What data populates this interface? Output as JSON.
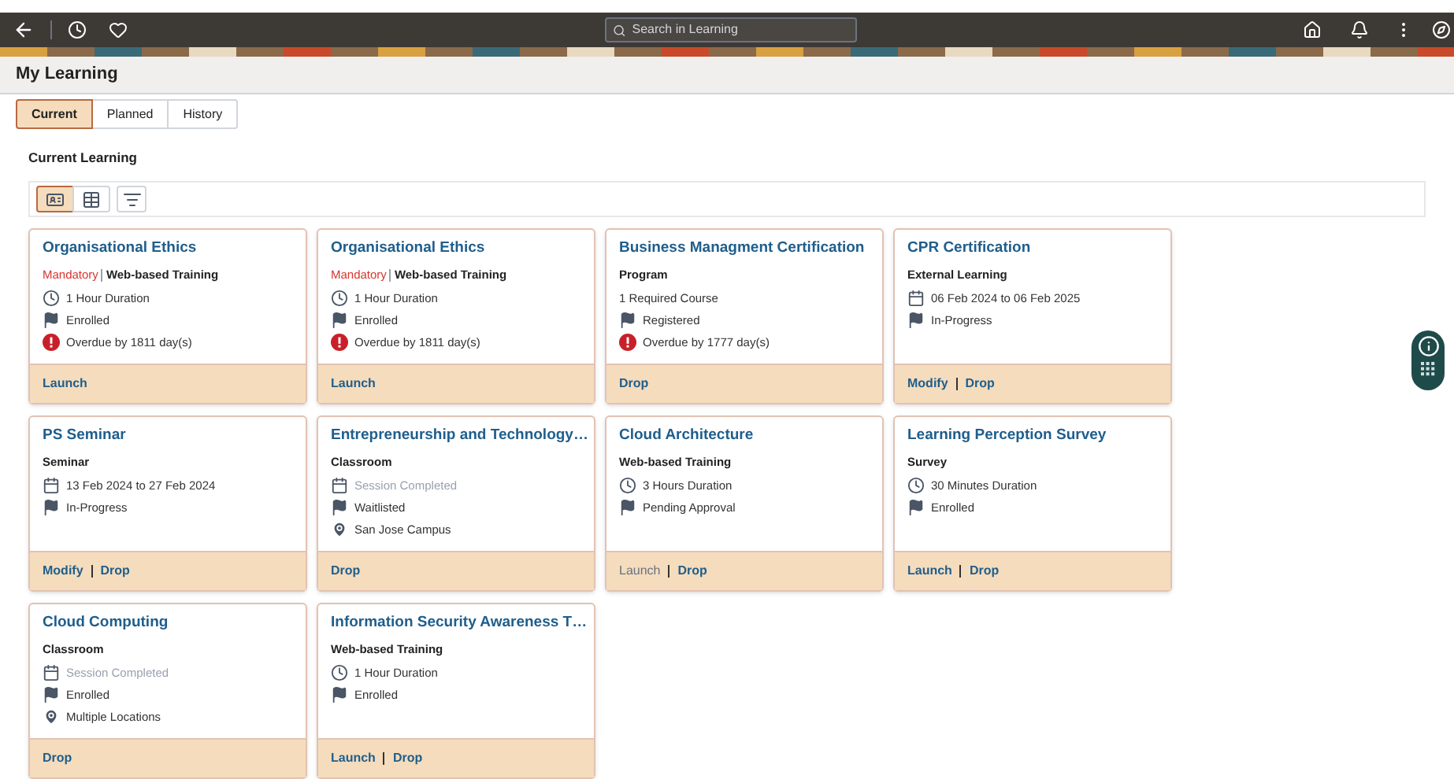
{
  "search": {
    "placeholder": "Search in Learning"
  },
  "page_title": "My Learning",
  "tabs": [
    {
      "label": "Current",
      "selected": true
    },
    {
      "label": "Planned",
      "selected": false
    },
    {
      "label": "History",
      "selected": false
    }
  ],
  "section_title": "Current Learning",
  "view_buttons": [
    {
      "kind": "cards",
      "selected": true
    },
    {
      "kind": "table",
      "selected": false
    },
    {
      "kind": "filter",
      "selected": false
    }
  ],
  "cards": [
    {
      "title": "Organisational Ethics",
      "mandatory": "Mandatory",
      "type": "Web-based Training",
      "lines": [
        {
          "kind": "duration",
          "text": "1 Hour Duration",
          "disabled": false
        },
        {
          "kind": "status",
          "text": "Enrolled",
          "disabled": false
        },
        {
          "kind": "overdue",
          "text": "Overdue by 1811 day(s)",
          "disabled": false
        }
      ],
      "actions": [
        {
          "label": "Launch",
          "disabled": false
        }
      ]
    },
    {
      "title": "Organisational Ethics",
      "mandatory": "Mandatory",
      "type": "Web-based Training",
      "lines": [
        {
          "kind": "duration",
          "text": "1 Hour Duration",
          "disabled": false
        },
        {
          "kind": "status",
          "text": "Enrolled",
          "disabled": false
        },
        {
          "kind": "overdue",
          "text": "Overdue by 1811 day(s)",
          "disabled": false
        }
      ],
      "actions": [
        {
          "label": "Launch",
          "disabled": false
        }
      ]
    },
    {
      "title": "Business Managment Certification",
      "type": "Program",
      "lines": [
        {
          "kind": "text",
          "text": "1 Required Course",
          "disabled": false
        },
        {
          "kind": "status",
          "text": "Registered",
          "disabled": false
        },
        {
          "kind": "overdue",
          "text": "Overdue by 1777 day(s)",
          "disabled": false
        }
      ],
      "actions": [
        {
          "label": "Drop",
          "disabled": false
        }
      ]
    },
    {
      "title": "CPR Certification",
      "type": "External Learning",
      "lines": [
        {
          "kind": "dates",
          "text": "06 Feb 2024 to 06 Feb 2025",
          "disabled": false
        },
        {
          "kind": "status",
          "text": "In-Progress",
          "disabled": false
        }
      ],
      "actions": [
        {
          "label": "Modify",
          "disabled": false
        },
        {
          "label": "Drop",
          "disabled": false
        }
      ]
    },
    {
      "title": "PS Seminar",
      "type": "Seminar",
      "lines": [
        {
          "kind": "dates",
          "text": "13 Feb 2024 to 27 Feb 2024",
          "disabled": false
        },
        {
          "kind": "status",
          "text": "In-Progress",
          "disabled": false
        }
      ],
      "actions": [
        {
          "label": "Modify",
          "disabled": false
        },
        {
          "label": "Drop",
          "disabled": false
        }
      ]
    },
    {
      "title": "Entrepreneurship and Technology…",
      "type": "Classroom",
      "lines": [
        {
          "kind": "dates",
          "text": "Session Completed",
          "disabled": true
        },
        {
          "kind": "status",
          "text": "Waitlisted",
          "disabled": false
        },
        {
          "kind": "location",
          "text": "San Jose Campus",
          "disabled": false
        }
      ],
      "actions": [
        {
          "label": "Drop",
          "disabled": false
        }
      ]
    },
    {
      "title": "Cloud Architecture",
      "type": "Web-based Training",
      "lines": [
        {
          "kind": "duration",
          "text": "3 Hours Duration",
          "disabled": false
        },
        {
          "kind": "status",
          "text": "Pending Approval",
          "disabled": false
        }
      ],
      "actions": [
        {
          "label": "Launch",
          "disabled": true
        },
        {
          "label": "Drop",
          "disabled": false
        }
      ]
    },
    {
      "title": "Learning Perception Survey",
      "type": "Survey",
      "lines": [
        {
          "kind": "duration",
          "text": "30 Minutes Duration",
          "disabled": false
        },
        {
          "kind": "status",
          "text": "Enrolled",
          "disabled": false
        }
      ],
      "actions": [
        {
          "label": "Launch",
          "disabled": false
        },
        {
          "label": "Drop",
          "disabled": false
        }
      ]
    },
    {
      "title": "Cloud Computing",
      "type": "Classroom",
      "lines": [
        {
          "kind": "dates",
          "text": "Session Completed",
          "disabled": true
        },
        {
          "kind": "status",
          "text": "Enrolled",
          "disabled": false
        },
        {
          "kind": "location",
          "text": "Multiple Locations",
          "disabled": false
        }
      ],
      "actions": [
        {
          "label": "Drop",
          "disabled": false
        }
      ]
    },
    {
      "title": "Information Security Awareness T…",
      "type": "Web-based Training",
      "lines": [
        {
          "kind": "duration",
          "text": "1 Hour Duration",
          "disabled": false
        },
        {
          "kind": "status",
          "text": "Enrolled",
          "disabled": false
        }
      ],
      "actions": [
        {
          "label": "Launch",
          "disabled": false
        },
        {
          "label": "Drop",
          "disabled": false
        }
      ]
    }
  ]
}
